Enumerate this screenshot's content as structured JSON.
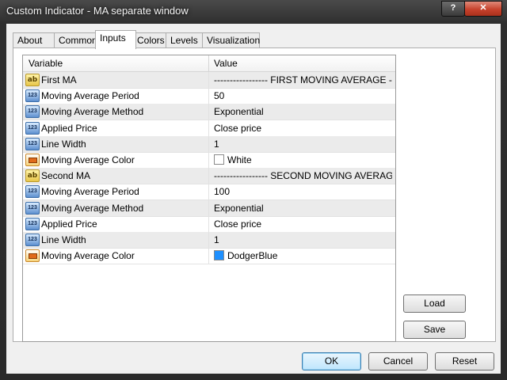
{
  "window": {
    "title": "Custom Indicator - MA separate window",
    "help_glyph": "?",
    "close_glyph": "✕"
  },
  "tabs": [
    {
      "label": "About"
    },
    {
      "label": "Common"
    },
    {
      "label": "Inputs",
      "active": true
    },
    {
      "label": "Colors"
    },
    {
      "label": "Levels"
    },
    {
      "label": "Visualization"
    }
  ],
  "grid": {
    "columns": {
      "variable": "Variable",
      "value": "Value"
    },
    "rows": [
      {
        "icon": "ab",
        "variable": "First MA",
        "value": "----------------- FIRST MOVING AVERAGE -------..."
      },
      {
        "icon": "123",
        "variable": "Moving Average Period",
        "value": "50"
      },
      {
        "icon": "123",
        "variable": "Moving Average Method",
        "value": "Exponential"
      },
      {
        "icon": "123",
        "variable": "Applied Price",
        "value": "Close price"
      },
      {
        "icon": "123",
        "variable": "Line Width",
        "value": "1"
      },
      {
        "icon": "color",
        "variable": "Moving Average Color",
        "value": "White",
        "swatch": "#ffffff"
      },
      {
        "icon": "ab",
        "variable": "Second MA",
        "value": "----------------- SECOND MOVING AVERAGE ----..."
      },
      {
        "icon": "123",
        "variable": "Moving Average Period",
        "value": "100"
      },
      {
        "icon": "123",
        "variable": "Moving Average Method",
        "value": "Exponential"
      },
      {
        "icon": "123",
        "variable": "Applied Price",
        "value": "Close price"
      },
      {
        "icon": "123",
        "variable": "Line Width",
        "value": "1"
      },
      {
        "icon": "color",
        "variable": "Moving Average Color",
        "value": "DodgerBlue",
        "swatch": "#1e90ff"
      }
    ]
  },
  "side_buttons": {
    "load": "Load",
    "save": "Save"
  },
  "footer": {
    "ok": "OK",
    "cancel": "Cancel",
    "reset": "Reset"
  }
}
